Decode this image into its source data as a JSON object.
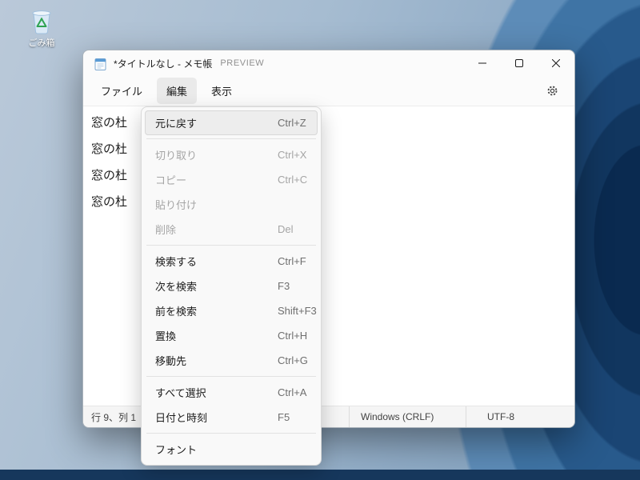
{
  "desktop": {
    "recycle_bin": {
      "label": "ごみ箱",
      "icon": "recycle-bin-icon"
    }
  },
  "colors": {
    "menu_highlight": "#ededed",
    "disabled_text": "#a5a5a5",
    "taskbar": "#16375c",
    "wallpaper_dark": "#0a2a50",
    "wallpaper_light": "#bac9d9"
  },
  "window": {
    "title": "*タイトルなし - メモ帳",
    "preview_label": "PREVIEW",
    "app_icon": "notepad-icon",
    "controls": [
      {
        "name": "minimize",
        "glyph": "minimize-icon"
      },
      {
        "name": "maximize",
        "glyph": "maximize-icon"
      },
      {
        "name": "close",
        "glyph": "close-icon"
      }
    ],
    "menubar": [
      {
        "name": "file",
        "label": "ファイル",
        "active": false
      },
      {
        "name": "edit",
        "label": "編集",
        "active": true
      },
      {
        "name": "view",
        "label": "表示",
        "active": false
      }
    ],
    "settings_icon": "gear-icon",
    "editor": {
      "lines": [
        "窓の杜",
        "窓の杜",
        "窓の杜",
        "窓の杜"
      ]
    },
    "statusbar": {
      "cursor_position": "行 9、列 1",
      "line_ending": "Windows (CRLF)",
      "encoding": "UTF-8"
    }
  },
  "edit_menu": {
    "items": [
      {
        "type": "item",
        "name": "undo",
        "label": "元に戻す",
        "shortcut": "Ctrl+Z",
        "enabled": true,
        "highlighted": true
      },
      {
        "type": "separator"
      },
      {
        "type": "item",
        "name": "cut",
        "label": "切り取り",
        "shortcut": "Ctrl+X",
        "enabled": false,
        "highlighted": false
      },
      {
        "type": "item",
        "name": "copy",
        "label": "コピー",
        "shortcut": "Ctrl+C",
        "enabled": false,
        "highlighted": false
      },
      {
        "type": "item",
        "name": "paste",
        "label": "貼り付け",
        "shortcut": "",
        "enabled": false,
        "highlighted": false
      },
      {
        "type": "item",
        "name": "delete",
        "label": "削除",
        "shortcut": "Del",
        "enabled": false,
        "highlighted": false
      },
      {
        "type": "separator"
      },
      {
        "type": "item",
        "name": "find",
        "label": "検索する",
        "shortcut": "Ctrl+F",
        "enabled": true,
        "highlighted": false
      },
      {
        "type": "item",
        "name": "find-next",
        "label": "次を検索",
        "shortcut": "F3",
        "enabled": true,
        "highlighted": false
      },
      {
        "type": "item",
        "name": "find-previous",
        "label": "前を検索",
        "shortcut": "Shift+F3",
        "enabled": true,
        "highlighted": false
      },
      {
        "type": "item",
        "name": "replace",
        "label": "置換",
        "shortcut": "Ctrl+H",
        "enabled": true,
        "highlighted": false
      },
      {
        "type": "item",
        "name": "go-to",
        "label": "移動先",
        "shortcut": "Ctrl+G",
        "enabled": true,
        "highlighted": false
      },
      {
        "type": "separator"
      },
      {
        "type": "item",
        "name": "select-all",
        "label": "すべて選択",
        "shortcut": "Ctrl+A",
        "enabled": true,
        "highlighted": false
      },
      {
        "type": "item",
        "name": "date-time",
        "label": "日付と時刻",
        "shortcut": "F5",
        "enabled": true,
        "highlighted": false
      },
      {
        "type": "separator"
      },
      {
        "type": "item",
        "name": "font",
        "label": "フォント",
        "shortcut": "",
        "enabled": true,
        "highlighted": false
      }
    ]
  }
}
